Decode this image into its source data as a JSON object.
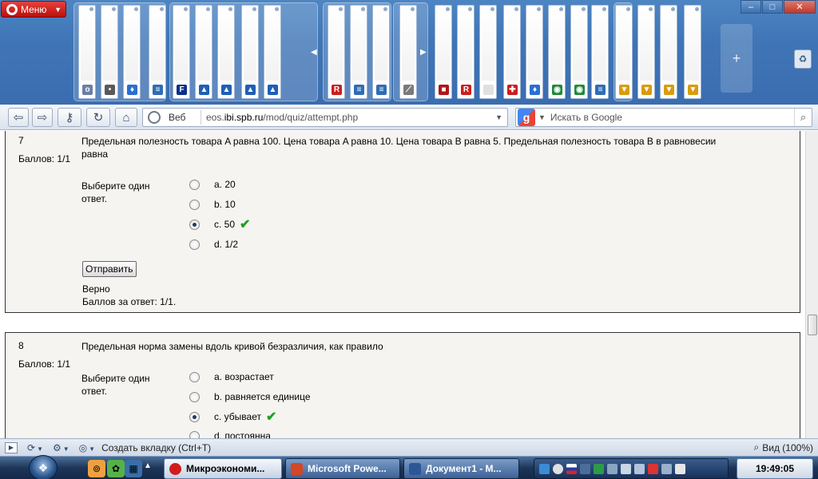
{
  "browser": {
    "menu_label": "Меню",
    "window_controls": [
      "–",
      "□",
      "✕"
    ],
    "address": {
      "scope_label": "Веб",
      "url_prefix": "eos.",
      "url_domain": "ibi.spb.ru",
      "url_path": "/mod/quiz/attempt.php"
    },
    "search": {
      "placeholder": "Искать в Google"
    },
    "new_tab_symbol": "+"
  },
  "tab_thumbnails": [
    {
      "icon": "opera-icon",
      "fav_color": "#6b7fa6",
      "fav_text": "o"
    },
    {
      "icon": "loading-icon",
      "fav_color": "#5a5a5a",
      "fav_text": "•"
    },
    {
      "icon": "pin-icon",
      "fav_color": "#2a6fd1",
      "fav_text": "♦"
    },
    {
      "icon": "document-icon",
      "fav_color": "#2f6db5",
      "fav_text": "≡"
    },
    {
      "icon": "f-icon",
      "fav_color": "#0d2f8a",
      "fav_text": "F"
    },
    {
      "icon": "flag-icon",
      "fav_color": "#1f5fb8",
      "fav_text": "▲"
    },
    {
      "icon": "flag-icon",
      "fav_color": "#1f5fb8",
      "fav_text": "▲"
    },
    {
      "icon": "flag-icon",
      "fav_color": "#1f5fb8",
      "fav_text": "▲"
    },
    {
      "icon": "flag-icon",
      "fav_color": "#1f5fb8",
      "fav_text": "▲"
    },
    {
      "icon": "rb-icon",
      "fav_color": "#c8201e",
      "fav_text": "R"
    },
    {
      "icon": "document-icon",
      "fav_color": "#2f6db5",
      "fav_text": "≡"
    },
    {
      "icon": "document-icon",
      "fav_color": "#2f6db5",
      "fav_text": "≡"
    },
    {
      "icon": "tool-icon",
      "fav_color": "#7a7a7a",
      "fav_text": "⟋"
    },
    {
      "icon": "flag-icon",
      "fav_color": "#b0161a",
      "fav_text": "■"
    },
    {
      "icon": "r-icon",
      "fav_color": "#c8201e",
      "fav_text": "R"
    },
    {
      "icon": "blank-icon",
      "fav_color": "#e0e0e0",
      "fav_text": ""
    },
    {
      "icon": "uk-flag-icon",
      "fav_color": "#c81e1e",
      "fav_text": "✚"
    },
    {
      "icon": "pin-icon",
      "fav_color": "#2a6fd1",
      "fav_text": "♦"
    },
    {
      "icon": "chat-icon",
      "fav_color": "#1f8a3a",
      "fav_text": "◉"
    },
    {
      "icon": "chat-icon",
      "fav_color": "#1f8a3a",
      "fav_text": "◉"
    },
    {
      "icon": "document-icon",
      "fav_color": "#2f6db5",
      "fav_text": "≡"
    },
    {
      "icon": "cap-icon",
      "fav_color": "#d99b0f",
      "fav_text": "▼"
    },
    {
      "icon": "cap-icon",
      "fav_color": "#d99b0f",
      "fav_text": "▼"
    },
    {
      "icon": "cap-icon",
      "fav_color": "#d99b0f",
      "fav_text": "▼"
    },
    {
      "icon": "cap-icon",
      "fav_color": "#d99b0f",
      "fav_text": "▼"
    }
  ],
  "quiz": {
    "q7": {
      "number": "7",
      "score": "Баллов: 1/1",
      "text": "Предельная полезность товара A равна 100. Цена товара A равна 10. Цена товара B равна 5. Предельная полезность товара B в равновесии равна",
      "choose_label": "Выберите один ответ.",
      "options": [
        {
          "label": "a. 20",
          "checked": false
        },
        {
          "label": "b. 10",
          "checked": false
        },
        {
          "label": "c. 50",
          "checked": true
        },
        {
          "label": "d. 1/2",
          "checked": false
        }
      ],
      "submit_label": "Отправить",
      "feedback": "Верно",
      "points": "Баллов за ответ: 1/1."
    },
    "q8": {
      "number": "8",
      "score": "Баллов: 1/1",
      "text": "Предельная норма замены вдоль кривой безразличия, как правило",
      "choose_label": "Выберите один ответ.",
      "options": [
        {
          "label": "a. возрастает",
          "checked": false
        },
        {
          "label": "b. равняется единице",
          "checked": false
        },
        {
          "label": "c. убывает",
          "checked": true
        },
        {
          "label": "d. постоянна",
          "checked": false
        }
      ]
    },
    "check_mark": "✔"
  },
  "statusbar": {
    "new_tab_label": "Создать вкладку (Ctrl+T)",
    "zoom_label": "Вид (100%)"
  },
  "taskbar": {
    "buttons": [
      {
        "label": "Микроэкономи...",
        "icon_color": "#d01c1c",
        "active": true
      },
      {
        "label": "Microsoft Powe...",
        "icon_color": "#d24726",
        "active": false
      },
      {
        "label": "Документ1 - M...",
        "icon_color": "#2b5797",
        "active": false
      }
    ],
    "clock": "19:49:05"
  },
  "colors": {
    "chrome_blue": "#3f75b6",
    "question_bg": "#f5f4f0",
    "correct_green": "#1fa01f"
  }
}
